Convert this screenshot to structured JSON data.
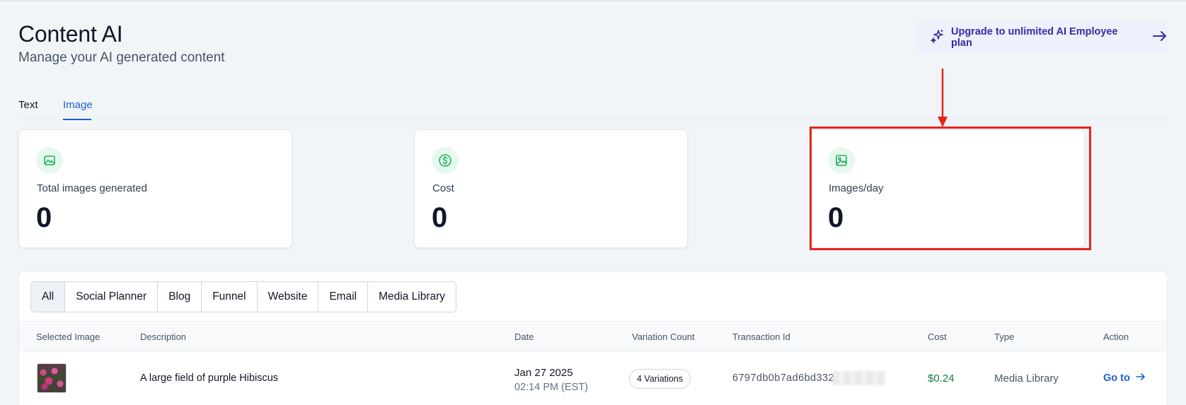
{
  "header": {
    "title": "Content AI",
    "subtitle": "Manage your AI generated content",
    "upgrade_label": "Upgrade to unlimited AI Employee plan"
  },
  "tabs": [
    {
      "label": "Text",
      "active": false
    },
    {
      "label": "Image",
      "active": true
    }
  ],
  "stats": [
    {
      "label": "Total images generated",
      "value": "0",
      "icon": "image-frame-icon"
    },
    {
      "label": "Cost",
      "value": "0",
      "icon": "dollar-circle-icon"
    },
    {
      "label": "Images/day",
      "value": "0",
      "icon": "image-icon"
    }
  ],
  "filters": [
    {
      "label": "All",
      "active": true
    },
    {
      "label": "Social Planner",
      "active": false
    },
    {
      "label": "Blog",
      "active": false
    },
    {
      "label": "Funnel",
      "active": false
    },
    {
      "label": "Website",
      "active": false
    },
    {
      "label": "Email",
      "active": false
    },
    {
      "label": "Media Library",
      "active": false
    }
  ],
  "table": {
    "columns": [
      "Selected Image",
      "Description",
      "Date",
      "Variation Count",
      "Transaction Id",
      "Cost",
      "Type",
      "Action"
    ],
    "rows": [
      {
        "description": "A large field of purple Hibiscus",
        "date": "Jan 27 2025",
        "time": "02:14 PM (EST)",
        "variations": "4 Variations",
        "transaction_id": "6797db0b7ad6bd332",
        "cost": "$0.24",
        "type": "Media Library",
        "action": "Go to"
      }
    ]
  },
  "colors": {
    "accent": "#1d5fd6",
    "upgrade_text": "#3b2aa8",
    "success": "#17803d",
    "annotation_red": "#e8221d",
    "stat_icon_bg": "#e7f8ee",
    "stat_icon": "#22b35e"
  }
}
